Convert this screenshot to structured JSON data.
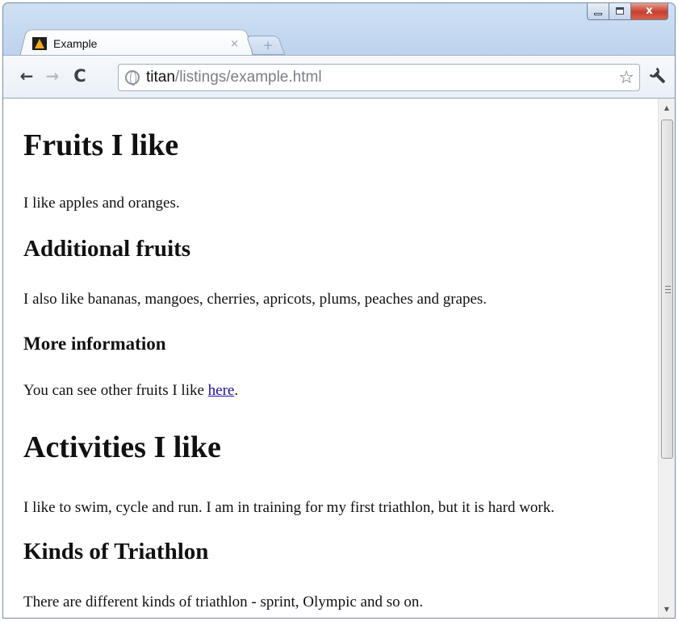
{
  "window": {
    "minimize_label": "",
    "maximize_label": "",
    "close_label": "x"
  },
  "tab": {
    "title": "Example",
    "close_label": "×",
    "new_tab_label": "+"
  },
  "toolbar": {
    "back_label": "←",
    "forward_label": "→",
    "reload_label": "C",
    "url_host": "titan",
    "url_path": "/listings/example.html",
    "star_label": "☆",
    "wrench_label": "🔧"
  },
  "page": {
    "h1_fruits": "Fruits I like",
    "p_fruits": "I like apples and oranges.",
    "h2_additional": "Additional fruits",
    "p_additional": "I also like bananas, mangoes, cherries, apricots, plums, peaches and grapes.",
    "h3_more": "More information",
    "p_more_prefix": "You can see other fruits I like ",
    "p_more_link": "here",
    "p_more_suffix": ".",
    "h1_activities": "Activities I like",
    "p_activities": "I like to swim, cycle and run. I am in training for my first triathlon, but it is hard work.",
    "h2_kinds": "Kinds of Triathlon",
    "p_kinds": "There are different kinds of triathlon - sprint, Olympic and so on."
  },
  "scrollbar": {
    "up_label": "▲",
    "down_label": "▼"
  }
}
